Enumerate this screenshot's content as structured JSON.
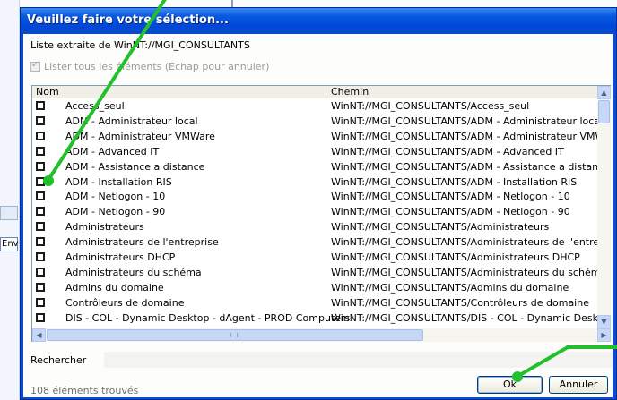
{
  "background": {
    "fragment_text": "Env"
  },
  "dialog": {
    "title": "Veuillez faire votre sélection...",
    "source_label": "Liste extraite de WinNT://MGI_CONSULTANTS",
    "list_all_label": "Lister tous les éléments (Echap pour annuler)",
    "columns": {
      "name": "Nom",
      "path": "Chemin"
    },
    "rows": [
      {
        "name": "Access_seul",
        "path": "WinNT://MGI_CONSULTANTS/Access_seul"
      },
      {
        "name": "ADM - Administrateur local",
        "path": "WinNT://MGI_CONSULTANTS/ADM - Administrateur local"
      },
      {
        "name": "ADM - Administrateur VMWare",
        "path": "WinNT://MGI_CONSULTANTS/ADM - Administrateur VMWare"
      },
      {
        "name": "ADM - Advanced IT",
        "path": "WinNT://MGI_CONSULTANTS/ADM - Advanced IT"
      },
      {
        "name": "ADM - Assistance a distance",
        "path": "WinNT://MGI_CONSULTANTS/ADM - Assistance a distance"
      },
      {
        "name": "ADM - Installation RIS",
        "path": "WinNT://MGI_CONSULTANTS/ADM - Installation RIS"
      },
      {
        "name": "ADM - Netlogon - 10",
        "path": "WinNT://MGI_CONSULTANTS/ADM - Netlogon - 10"
      },
      {
        "name": "ADM - Netlogon - 90",
        "path": "WinNT://MGI_CONSULTANTS/ADM - Netlogon - 90"
      },
      {
        "name": "Administrateurs",
        "path": "WinNT://MGI_CONSULTANTS/Administrateurs"
      },
      {
        "name": "Administrateurs de l'entreprise",
        "path": "WinNT://MGI_CONSULTANTS/Administrateurs de l'entreprise"
      },
      {
        "name": "Administrateurs DHCP",
        "path": "WinNT://MGI_CONSULTANTS/Administrateurs DHCP"
      },
      {
        "name": "Administrateurs du schéma",
        "path": "WinNT://MGI_CONSULTANTS/Administrateurs du schéma"
      },
      {
        "name": "Admins du domaine",
        "path": "WinNT://MGI_CONSULTANTS/Admins du domaine"
      },
      {
        "name": "Contrôleurs de domaine",
        "path": "WinNT://MGI_CONSULTANTS/Contrôleurs de domaine"
      },
      {
        "name": "DIS - COL - Dynamic Desktop - dAgent - PROD Computers",
        "path": "WinNT://MGI_CONSULTANTS/DIS - COL - Dynamic Desktop"
      }
    ],
    "search_label": "Rechercher",
    "search_value": "",
    "count_label": "108 éléments trouvés",
    "ok_label": "Ok",
    "cancel_label": "Annuler",
    "icons": {
      "scroll_up": "▲",
      "scroll_down": "▼",
      "scroll_left": "◀",
      "scroll_right": "▶"
    }
  },
  "colors": {
    "titlebar": "#0a4bd0",
    "annotation": "#22c02a"
  }
}
